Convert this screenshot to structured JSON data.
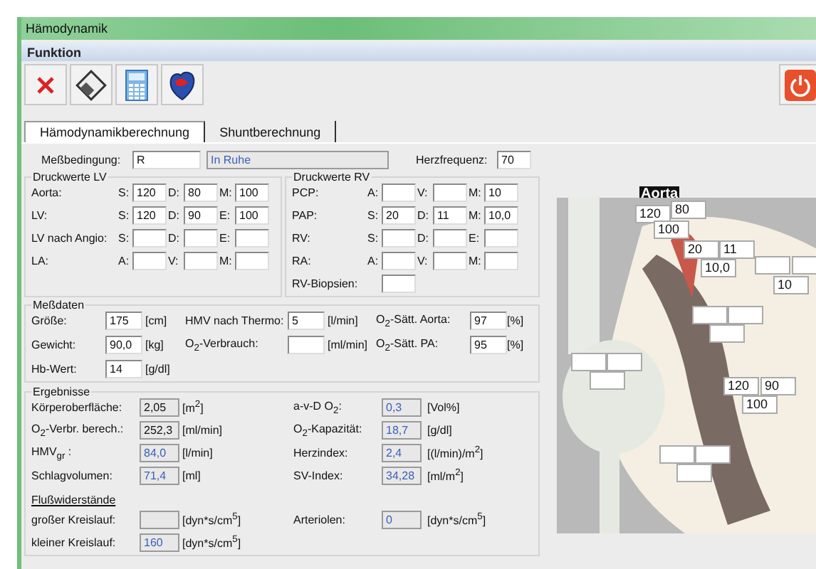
{
  "window": {
    "title": "Hämodynamik"
  },
  "menu": [
    {
      "label": "Funktion"
    }
  ],
  "tabs": [
    {
      "label": "Hämodynamikberechnung",
      "selected": true
    },
    {
      "label": "Shuntberechnung",
      "selected": false
    }
  ],
  "condition": {
    "label": "Meßbedingung:",
    "code": "R",
    "description": "In Ruhe",
    "heart_rate_label": "Herzfrequenz:",
    "heart_rate": "70"
  },
  "pressure_lv": {
    "title": "Druckwerte LV",
    "rows": [
      {
        "label": "Aorta:",
        "fields": [
          {
            "prefix": "S:",
            "value": "120"
          },
          {
            "prefix": "D:",
            "value": "80"
          },
          {
            "prefix": "M:",
            "value": "100"
          }
        ]
      },
      {
        "label": "LV:",
        "fields": [
          {
            "prefix": "S:",
            "value": "120"
          },
          {
            "prefix": "D:",
            "value": "90"
          },
          {
            "prefix": "E:",
            "value": "100"
          }
        ]
      },
      {
        "label": "LV nach Angio:",
        "fields": [
          {
            "prefix": "S:"
          },
          {
            "prefix": "D:"
          },
          {
            "prefix": "E:"
          }
        ]
      },
      {
        "label": "LA:",
        "fields": [
          {
            "prefix": "A:"
          },
          {
            "prefix": "V:"
          },
          {
            "prefix": "M:"
          }
        ]
      }
    ]
  },
  "pressure_rv": {
    "title": "Druckwerte RV",
    "rows": [
      {
        "label": "PCP:",
        "fields": [
          {
            "prefix": "A:"
          },
          {
            "prefix": "V:"
          },
          {
            "prefix": "M:",
            "value": "10"
          }
        ]
      },
      {
        "label": "PAP:",
        "fields": [
          {
            "prefix": "S:",
            "value": "20"
          },
          {
            "prefix": "D:",
            "value": "11"
          },
          {
            "prefix": "M:",
            "value": "10,0"
          }
        ]
      },
      {
        "label": "RV:",
        "fields": [
          {
            "prefix": "S:"
          },
          {
            "prefix": "D:"
          },
          {
            "prefix": "E:"
          }
        ]
      },
      {
        "label": "RA:",
        "fields": [
          {
            "prefix": "A:"
          },
          {
            "prefix": "V:"
          },
          {
            "prefix": "M:"
          }
        ]
      },
      {
        "label": "RV-Biopsien:",
        "kind": "single"
      }
    ]
  },
  "measurements": {
    "title": "Meßdaten",
    "rows": [
      {
        "cells": [
          {
            "label": "Größe:",
            "value": "175",
            "unit": "[cm]"
          },
          {
            "label": "HMV nach Thermo:",
            "value": "5",
            "unit": "[l/min]"
          },
          {
            "label": "O$_{2}$-Sätt. Aorta:",
            "value": "97",
            "unit": "[%]"
          }
        ]
      },
      {
        "cells": [
          {
            "label": "Gewicht:",
            "value": "90,0",
            "unit": "[kg]"
          },
          {
            "label": "O$_{2}$-Verbrauch:",
            "unit": "[ml/min]"
          },
          {
            "label": "O$_{2}$-Sätt. PA:",
            "value": "95",
            "unit": "[%]"
          }
        ]
      },
      {
        "cells": [
          {
            "label": "Hb-Wert:",
            "value": "14",
            "unit": "[g/dl]"
          }
        ]
      }
    ]
  },
  "results": {
    "title": "Ergebnisse",
    "rows": [
      {
        "cells": [
          {
            "label": "Körperoberfläche:",
            "value": "2,05",
            "unit": "[m$^{2}$]",
            "computed": false
          },
          {
            "label": "a-v-D O$_{2}$:",
            "value": "0,3",
            "unit": "[Vol%]",
            "computed": true
          }
        ]
      },
      {
        "cells": [
          {
            "label": "O$_{2}$-Verbr. berech.:",
            "value": "252,3",
            "unit": "[ml/min]",
            "computed": false
          },
          {
            "label": "O$_{2}$-Kapazität:",
            "value": "18,7",
            "unit": "[g/dl]",
            "computed": true
          }
        ]
      },
      {
        "cells": [
          {
            "label": "HMV$_{gr}$ :",
            "value": "84,0",
            "unit": "[l/min]",
            "computed": true
          },
          {
            "label": "Herzindex:",
            "value": "2,4",
            "unit": "[(l/min)/m$^{2}$]",
            "computed": true
          }
        ]
      },
      {
        "cells": [
          {
            "label": "Schlagvolumen:",
            "value": "71,4",
            "unit": "[ml]",
            "computed": true
          },
          {
            "label": "SV-Index:",
            "value": "34,28",
            "unit": "[ml/m$^{2}$]",
            "computed": true
          }
        ]
      }
    ],
    "resistance_title": "Flußwiderstände",
    "resistance_rows": [
      {
        "cells": [
          {
            "label": "großer Kreislauf:",
            "unit": "[dyn*s/cm$^{5}$]"
          },
          {
            "label": "Arteriolen:",
            "value": "0",
            "unit": "[dyn*s/cm$^{5}$]",
            "computed": true
          }
        ]
      },
      {
        "cells": [
          {
            "label": "kleiner Kreislauf:",
            "value": "160",
            "unit": "[dyn*s/cm$^{5}$]",
            "computed": true
          }
        ]
      }
    ]
  },
  "heart": {
    "caption": "Aorta",
    "readings": [
      "120",
      "80",
      "100",
      "20",
      "11",
      "10,0",
      "10",
      "120",
      "90",
      "100"
    ]
  }
}
